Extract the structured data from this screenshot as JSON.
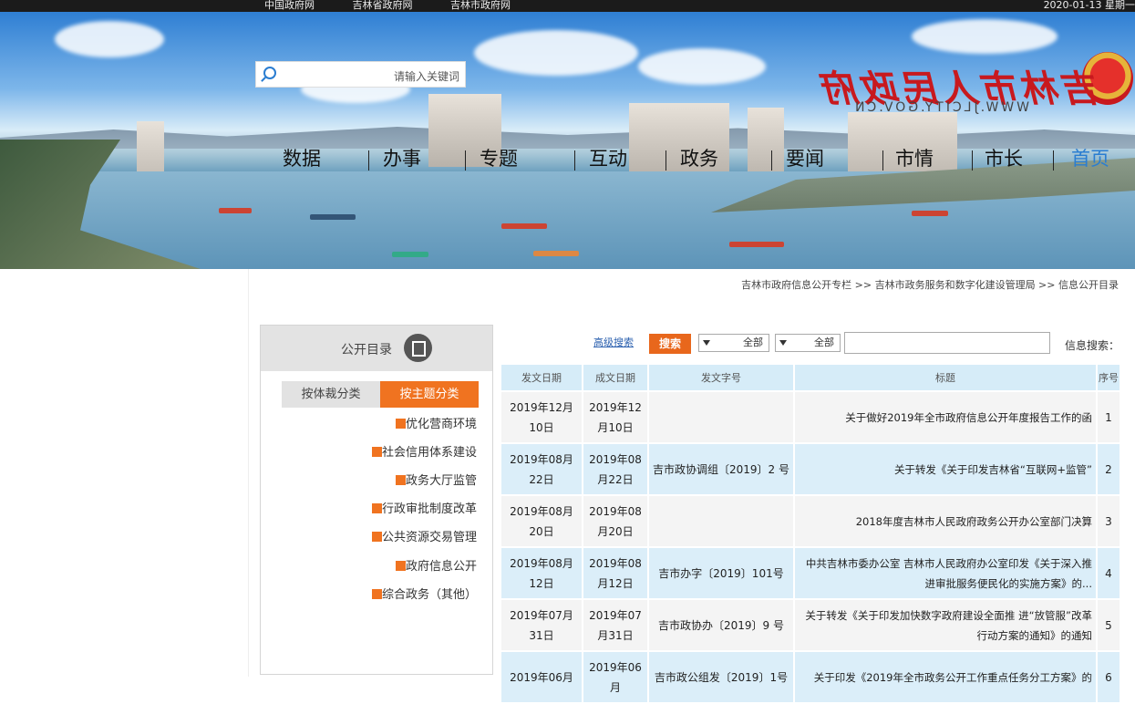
{
  "topbar": {
    "links": [
      "中国政府网",
      "吉林省政府网",
      "吉林市政府网"
    ],
    "date": "2020-01-13 星期一"
  },
  "header": {
    "search_placeholder": "请输入关键词",
    "site_title": "吉林市人民政府",
    "site_url": "WWW.JLCITY.GOV.CN"
  },
  "nav": [
    "首页",
    "市长",
    "市情",
    "要闻",
    "政务",
    "互动",
    "专题",
    "办事",
    "数据"
  ],
  "breadcrumb": "吉林市政府信息公开专栏 >> 吉林市政务服务和数字化建设管理局 >> 信息公开目录",
  "filter": {
    "label": "信息搜索：",
    "select1": "全部",
    "select2": "全部",
    "search_btn": "搜索",
    "advanced": "高级搜索"
  },
  "table": {
    "headers": [
      "序号",
      "标题",
      "发文字号",
      "成文日期",
      "发文日期"
    ],
    "rows": [
      {
        "no": "1",
        "title": "关于做好2019年全市政府信息公开年度报告工作的函",
        "doc_no": "",
        "written": "2019年12月10日",
        "issued": "2019年12月10日"
      },
      {
        "no": "2",
        "title": "关于转发《关于印发吉林省“互联网+监管”",
        "doc_no": "吉市政协调组〔2019〕2 号",
        "written": "2019年08月22日",
        "issued": "2019年08月22日"
      },
      {
        "no": "3",
        "title": "2018年度吉林市人民政府政务公开办公室部门决算",
        "doc_no": "",
        "written": "2019年08月20日",
        "issued": "2019年08月20日"
      },
      {
        "no": "4",
        "title": "中共吉林市委办公室 吉林市人民政府办公室印发《关于深入推进审批服务便民化的实施方案》的...",
        "doc_no": "吉市办字〔2019〕101号",
        "written": "2019年08月12日",
        "issued": "2019年08月12日"
      },
      {
        "no": "5",
        "title": "关于转发《关于印发加快数字政府建设全面推 进“放管服”改革行动方案的通知》的通知",
        "doc_no": "吉市政协办〔2019〕9 号",
        "written": "2019年07月31日",
        "issued": "2019年07月31日"
      },
      {
        "no": "6",
        "title": "关于印发《2019年全市政务公开工作重点任务分工方案》的",
        "doc_no": "吉市政公组发〔2019〕1号",
        "written": "2019年06月",
        "issued": "2019年06月"
      }
    ]
  },
  "sidebar": {
    "title": "公开目录",
    "tab_active": "按主题分类",
    "tab_inactive": "按体裁分类",
    "categories": [
      "优化营商环境",
      "社会信用体系建设",
      "政务大厅监管",
      "行政审批制度改革",
      "公共资源交易管理",
      "政府信息公开",
      "综合政务（其他）"
    ]
  }
}
